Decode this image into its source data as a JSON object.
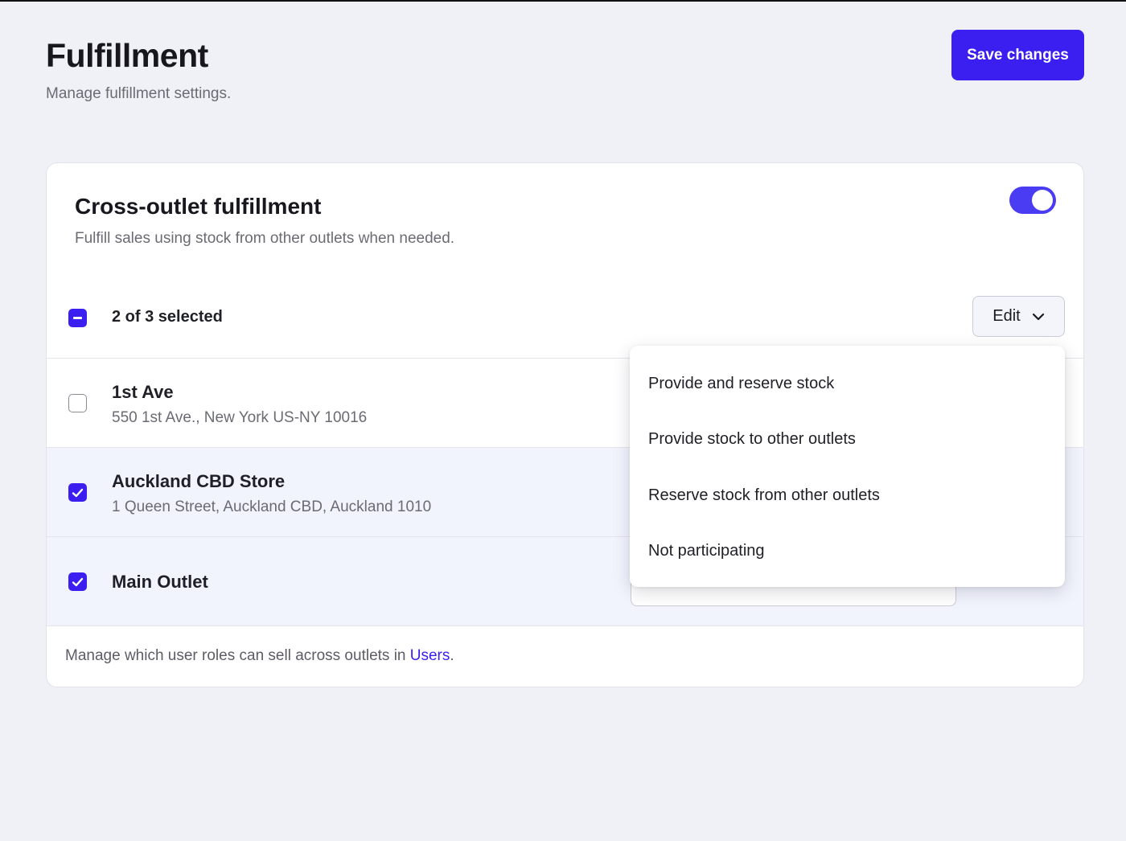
{
  "header": {
    "title": "Fulfillment",
    "subtitle": "Manage fulfillment settings.",
    "save_label": "Save changes"
  },
  "card": {
    "title": "Cross-outlet fulfillment",
    "description": "Fulfill sales using stock from other outlets when needed.",
    "toggle_on": true,
    "selection": {
      "count_label": "2 of 3 selected",
      "state": "indeterminate",
      "edit_label": "Edit"
    },
    "outlets": [
      {
        "name": "1st Ave",
        "address": "550 1st Ave., New York US-NY 10016",
        "checked": false
      },
      {
        "name": "Auckland CBD Store",
        "address": "1 Queen Street, Auckland CBD, Auckland 1010",
        "checked": true
      },
      {
        "name": "Main Outlet",
        "address": "",
        "checked": true
      }
    ],
    "footer": {
      "text": "Manage which user roles can sell across outlets in ",
      "link": "Users",
      "suffix": "."
    }
  },
  "dropdown": {
    "items": [
      "Provide and reserve stock",
      "Provide stock to other outlets",
      "Reserve stock from other outlets",
      "Not participating"
    ]
  },
  "colors": {
    "accent": "#3b1ff0",
    "toggle": "#4a3cf2",
    "background": "#f0f1f6",
    "selected_row": "#f1f3fd"
  },
  "icons": {
    "edit_chevron": "chevron-down-icon",
    "checkbox_check": "check-icon",
    "checkbox_indeterminate": "minus-icon"
  }
}
